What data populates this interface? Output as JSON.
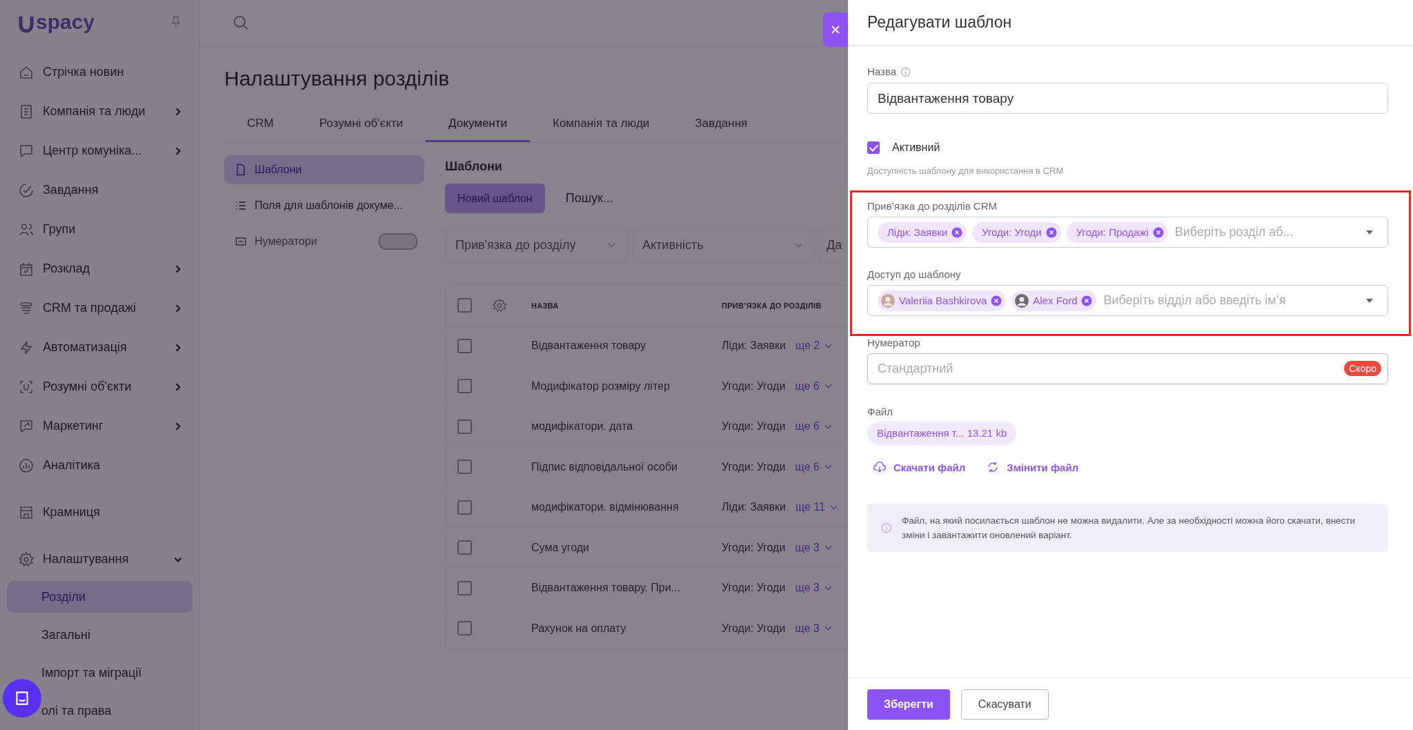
{
  "logo": {
    "text": "spacy"
  },
  "sidebar": {
    "sections": [
      {
        "items": [
          {
            "label": "Стрічка новин",
            "submenu": false
          },
          {
            "label": "Компанія та люди",
            "submenu": true,
            "expanded": false
          },
          {
            "label": "Центр комуніка...",
            "submenu": true,
            "expanded": false
          },
          {
            "label": "Завдання",
            "submenu": false
          },
          {
            "label": "Групи",
            "submenu": false
          },
          {
            "label": "Розклад",
            "submenu": true,
            "expanded": false
          },
          {
            "label": "CRM та продажі",
            "submenu": true,
            "expanded": false
          },
          {
            "label": "Автоматизація",
            "submenu": true,
            "expanded": false
          },
          {
            "label": "Розумні об'єкти",
            "submenu": true,
            "expanded": false
          },
          {
            "label": "Маркетинг",
            "submenu": true,
            "expanded": false
          },
          {
            "label": "Аналітика",
            "submenu": false
          }
        ]
      },
      {
        "items": [
          {
            "label": "Крамниця",
            "submenu": false
          }
        ]
      },
      {
        "items": [
          {
            "label": "Налаштування",
            "submenu": true,
            "expanded": true,
            "children": [
              {
                "label": "Розділи",
                "selected": true
              },
              {
                "label": "Загальні",
                "selected": false
              },
              {
                "label": "Імпорт та міграції",
                "selected": false
              },
              {
                "label": "олі та права",
                "selected": false
              }
            ]
          }
        ]
      }
    ]
  },
  "page": {
    "title": "Налаштування розділів",
    "tabs": [
      {
        "label": "CRM",
        "selected": false
      },
      {
        "label": "Розумні об'єкти",
        "selected": false
      },
      {
        "label": "Документи",
        "selected": true
      },
      {
        "label": "Компанія та люди",
        "selected": false
      },
      {
        "label": "Завдання",
        "selected": false
      }
    ],
    "subnav": [
      {
        "label": "Шаблони",
        "selected": true,
        "disabled": false,
        "soon_badge": false
      },
      {
        "label": "Поля для шаблонів докуме...",
        "selected": false,
        "disabled": false,
        "soon_badge": false
      },
      {
        "label": "Нумератори",
        "selected": false,
        "disabled": true,
        "soon_badge": true
      }
    ],
    "templates": {
      "heading": "Шаблони",
      "new_button": "Новий шаблон",
      "search": {
        "placeholder": "Пошук..."
      },
      "filters": [
        {
          "label": "Прив'язка до розділу",
          "kind": "dropdown"
        },
        {
          "label": "Активність",
          "kind": "dropdown"
        },
        {
          "label": "Да",
          "kind": "partial"
        }
      ],
      "table": {
        "columns": [
          "НАЗВА",
          "ПРИВ’ЯЗКА ДО РОЗДІЛІВ"
        ],
        "select_all_checked": false,
        "rows": [
          {
            "checked": false,
            "name": "Відвантаження товару",
            "section": "Ліди: Заявки",
            "more": "ще 2"
          },
          {
            "checked": false,
            "name": "Модифікатор розміру літер",
            "section": "Угоди: Угоди",
            "more": "ще 6"
          },
          {
            "checked": false,
            "name": "модифікатори. дата",
            "section": "Угоди: Угоди",
            "more": "ще 6"
          },
          {
            "checked": false,
            "name": "Підпис відповідальної особи",
            "section": "Угоди: Угоди",
            "more": "ще 6"
          },
          {
            "checked": false,
            "name": "модифікатори. відмінювання",
            "section": "Ліди: Заявки",
            "more": "ще 11"
          },
          {
            "checked": false,
            "name": "Сума угоди",
            "section": "Угоди: Угоди",
            "more": "ще 3"
          },
          {
            "checked": false,
            "name": "Відвантаження товару. При...",
            "section": "Угоди: Угоди",
            "more": "ще 3"
          },
          {
            "checked": false,
            "name": "Рахунок на оплату",
            "section": "Угоди: Угоди",
            "more": "ще 3"
          }
        ]
      }
    }
  },
  "drawer": {
    "title": "Редагувати шаблон",
    "name_field": {
      "label": "Назва",
      "value": "Відвантаження товару"
    },
    "active": {
      "label": "Активний",
      "checked": true,
      "hint": "Доступність шаблону для використання в CRM"
    },
    "highlighted": true,
    "crm_sections": {
      "label": "Прив’язка до розділів CRM",
      "tags": [
        "Ліди: Заявки",
        "Угоди: Угоди",
        "Угоди: Продажі"
      ],
      "placeholder": "Виберіть розділ аб..."
    },
    "access": {
      "label": "Доступ до шаблону",
      "tags": [
        "Valeriia Bashkirova",
        "Alex Ford"
      ],
      "placeholder": "Виберіть відділ або введіть ім’я"
    },
    "numerator": {
      "label": "Нумератор",
      "placeholder": "Стандартний",
      "badge": "Скоро"
    },
    "file": {
      "label": "Файл",
      "chip": "Відвантаження т... 13.21 kb",
      "actions": [
        "Скачати файл",
        "Змінити файл"
      ]
    },
    "note": "Файл, на який посилається шаблон не можна видалити. Але за необхідності можна його скачати, внести зміни і завантажити оновлений варіант.",
    "buttons": [
      {
        "label": "Зберегти",
        "kind": "primary"
      },
      {
        "label": "Скасувати",
        "kind": "secondary"
      }
    ]
  }
}
